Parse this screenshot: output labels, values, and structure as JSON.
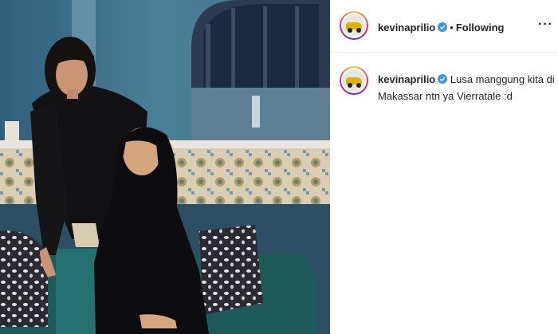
{
  "post": {
    "author": {
      "username": "kevinaprilio",
      "verified": true,
      "avatar_icon": "avatar-car-photo"
    },
    "follow_status": "Following",
    "separator": "•",
    "more_menu": "···",
    "caption": "Lusa manggung kita di Makassar ntn ya Vierratale :d"
  },
  "colors": {
    "verified_badge": "#3897f0",
    "text": "#262626",
    "divider": "#efefef",
    "photo_wall": "#3f6f86"
  }
}
